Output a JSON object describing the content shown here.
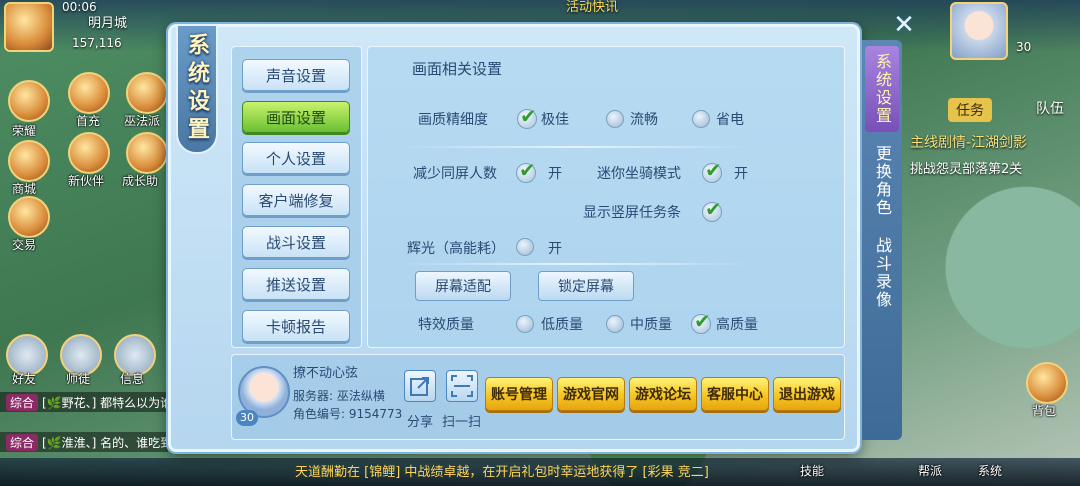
{
  "background": {
    "top_time": "00:06",
    "location": "明月城",
    "currency": "157,116",
    "event_text": "活动快讯",
    "left_icons": [
      "荣耀",
      "首充",
      "巫法派",
      "商城",
      "新伙伴",
      "成长助",
      "交易"
    ],
    "bottom_left": [
      "好友",
      "师徒",
      "信息"
    ],
    "chat": [
      {
        "tag": "综合",
        "text": "[🌿野花、] 都特么以为谁是"
      },
      {
        "tag": "综合",
        "text": "[🌿淮淮、] 名的、谁吃到让我爱吃到"
      }
    ],
    "ticker": "天道酬勤在 [锦鲤] 中战绩卓越，在开启礼包时幸运地获得了 [彩果 竞二]",
    "right_hud": {
      "player_level": "30",
      "task_tab": "任务",
      "team_tab": "队伍",
      "quest_title": "主线剧情-江湖剑影",
      "quest_desc": "挑战怨灵部落第2关",
      "bag": "背包"
    },
    "bottom_bar": [
      "技能",
      "帮派",
      "系统"
    ]
  },
  "dialog": {
    "title": "系统设置",
    "menu": [
      {
        "label": "声音设置",
        "active": false
      },
      {
        "label": "画面设置",
        "active": true
      },
      {
        "label": "个人设置",
        "active": false
      },
      {
        "label": "客户端修复",
        "active": false
      },
      {
        "label": "战斗设置",
        "active": false
      },
      {
        "label": "推送设置",
        "active": false
      },
      {
        "label": "卡顿报告",
        "active": false
      }
    ],
    "section_title": "画面相关设置",
    "quality": {
      "label": "画质精细度",
      "options": [
        {
          "label": "极佳",
          "selected": true
        },
        {
          "label": "流畅",
          "selected": false
        },
        {
          "label": "省电",
          "selected": false
        }
      ]
    },
    "reduce_players": {
      "label": "减少同屏人数",
      "value": "开",
      "checked": true
    },
    "mini_mount": {
      "label": "迷你坐骑模式",
      "value": "开",
      "checked": true
    },
    "vertical_task": {
      "label": "显示竖屏任务条",
      "checked": true
    },
    "glow": {
      "label": "辉光（高能耗）",
      "value": "开",
      "checked": false
    },
    "buttons": {
      "fit_screen": "屏幕适配",
      "lock_screen": "锁定屏幕"
    },
    "effects": {
      "label": "特效质量",
      "options": [
        {
          "label": "低质量",
          "selected": false
        },
        {
          "label": "中质量",
          "selected": false
        },
        {
          "label": "高质量",
          "selected": true
        }
      ]
    },
    "account": {
      "name": "撩不动心弦",
      "server": "服务器: 巫法纵横",
      "role_id": "角色编号: 9154773",
      "level": "30",
      "share": "分享",
      "scan": "扫一扫",
      "actions": [
        "账号管理",
        "游戏官网",
        "游戏论坛",
        "客服中心",
        "退出游戏"
      ]
    },
    "side_tabs": [
      {
        "label": "系统设置",
        "active": true
      },
      {
        "label": "更换角色",
        "active": false
      },
      {
        "label": "战斗录像",
        "active": false
      }
    ]
  }
}
